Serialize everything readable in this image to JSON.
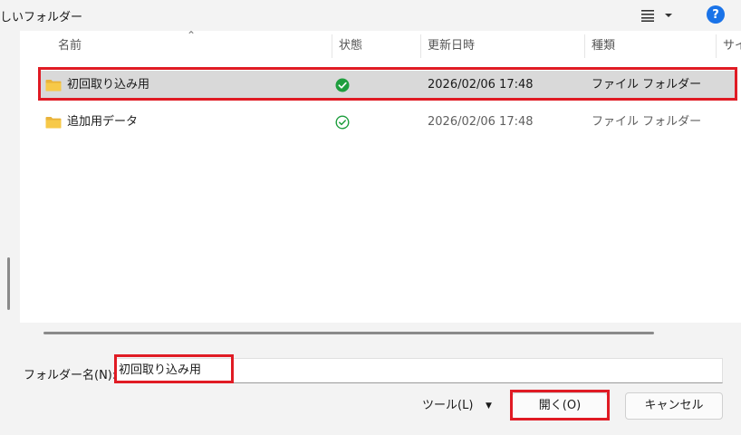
{
  "toolbar": {
    "new_folder_label": "しいフォルダー",
    "help_label": "?"
  },
  "columns": {
    "name": "名前",
    "status": "状態",
    "modified": "更新日時",
    "type": "種類",
    "size": "サイ"
  },
  "rows": [
    {
      "name": "初回取り込み用",
      "status": "synced",
      "modified": "2026/02/06 17:48",
      "type": "ファイル フォルダー",
      "selected": true
    },
    {
      "name": "追加用データ",
      "status": "available",
      "modified": "2026/02/06 17:48",
      "type": "ファイル フォルダー",
      "selected": false
    }
  ],
  "bottom": {
    "folder_label": "フォルダー名(N):",
    "folder_value": "初回取り込み用",
    "tools_label": "ツール(L)",
    "open_label": "開く(O)",
    "cancel_label": "キャンセル"
  },
  "colors": {
    "accent": "#1a73e8",
    "highlight": "#e01b24",
    "status_green": "#1e9e3e",
    "folder_yellow": "#f7c948"
  }
}
